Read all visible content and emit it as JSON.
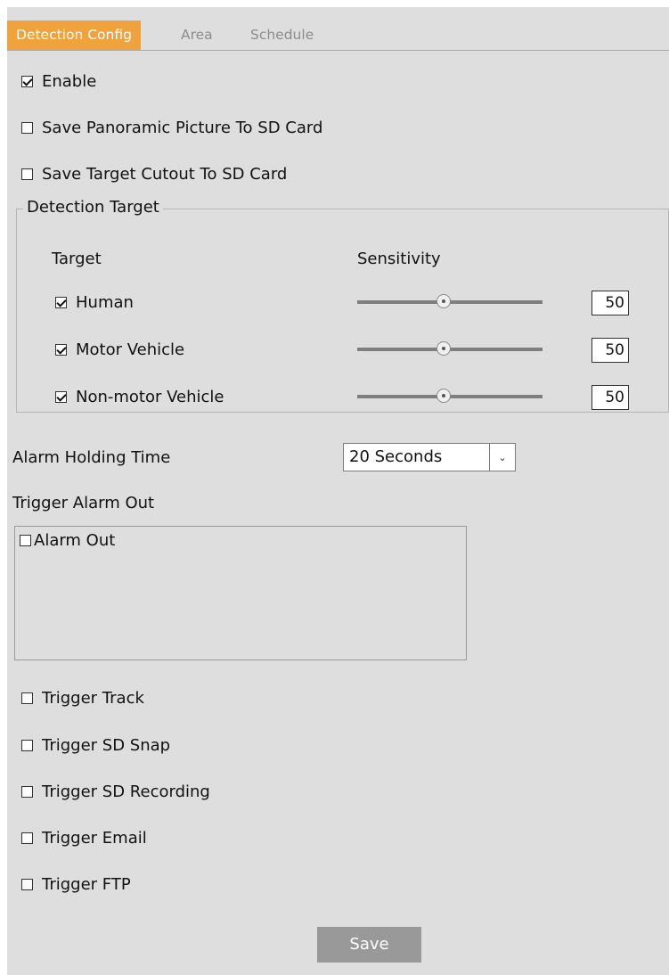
{
  "tabs": [
    {
      "label": "Detection Config",
      "active": true
    },
    {
      "label": "Area",
      "active": false
    },
    {
      "label": "Schedule",
      "active": false
    }
  ],
  "enable": {
    "label": "Enable",
    "checked": true
  },
  "save_panoramic": {
    "label": "Save Panoramic Picture To SD Card",
    "checked": false
  },
  "save_cutout": {
    "label": "Save Target Cutout To SD Card",
    "checked": false
  },
  "detection_target": {
    "legend": "Detection Target",
    "col_target": "Target",
    "col_sensitivity": "Sensitivity",
    "targets": [
      {
        "label": "Human",
        "checked": true,
        "sensitivity": "50"
      },
      {
        "label": "Motor Vehicle",
        "checked": true,
        "sensitivity": "50"
      },
      {
        "label": "Non-motor Vehicle",
        "checked": true,
        "sensitivity": "50"
      }
    ]
  },
  "alarm_holding": {
    "label": "Alarm Holding Time",
    "value": "20 Seconds"
  },
  "trigger_alarm_out": {
    "label": "Trigger Alarm Out",
    "item": "Alarm Out",
    "checked": false
  },
  "triggers": [
    {
      "label": "Trigger Track",
      "checked": false
    },
    {
      "label": "Trigger SD Snap",
      "checked": false
    },
    {
      "label": "Trigger SD Recording",
      "checked": false
    },
    {
      "label": "Trigger Email",
      "checked": false
    },
    {
      "label": "Trigger FTP",
      "checked": false
    }
  ],
  "save_button": "Save",
  "colors": {
    "accent": "#f0a23c",
    "panel_bg": "#dedede",
    "button_bg": "#999999"
  }
}
